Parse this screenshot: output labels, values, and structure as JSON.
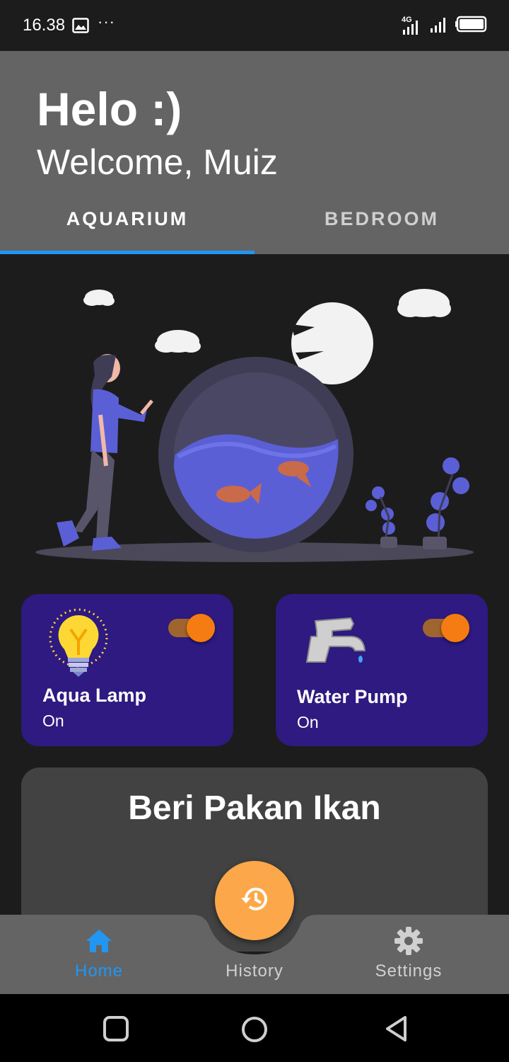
{
  "status_bar": {
    "time": "16.38",
    "dots": "···",
    "network": "4G"
  },
  "header": {
    "greeting": "Helo :)",
    "welcome": "Welcome, Muiz",
    "tabs": [
      {
        "label": "AQUARIUM",
        "selected": true
      },
      {
        "label": "BEDROOM",
        "selected": false
      }
    ]
  },
  "devices": [
    {
      "name": "Aqua Lamp",
      "state": "On",
      "icon": "lightbulb-icon",
      "enabled": true
    },
    {
      "name": "Water Pump",
      "state": "On",
      "icon": "faucet-icon",
      "enabled": true
    }
  ],
  "feed": {
    "title": "Beri Pakan Ikan"
  },
  "bottom_nav": {
    "items": [
      {
        "label": "Home",
        "icon": "home-icon",
        "active": true
      },
      {
        "label": "History",
        "icon": "history-icon",
        "active": false
      },
      {
        "label": "Settings",
        "icon": "gear-icon",
        "active": false
      }
    ]
  },
  "colors": {
    "accent": "#2196f3",
    "card": "#2e1a80",
    "toggle": "#f57c12",
    "fab": "#fca84a",
    "header": "#646464"
  }
}
